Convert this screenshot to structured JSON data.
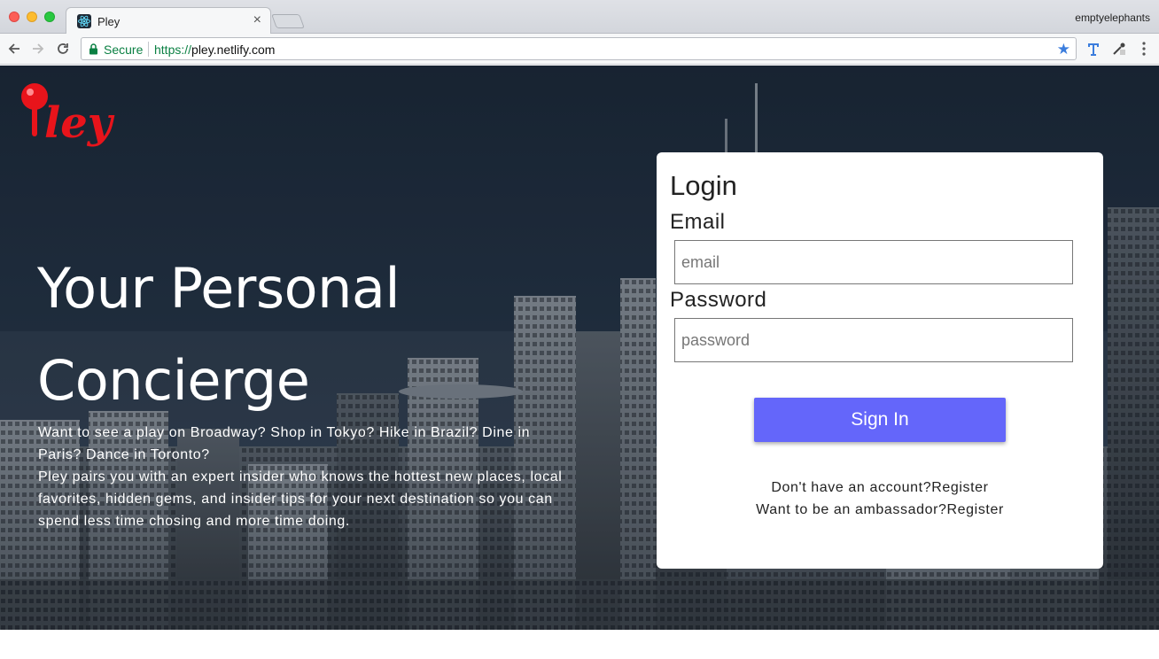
{
  "browser": {
    "tab_title": "Pley",
    "tab_close": "×",
    "profile_name": "emptyelephants",
    "secure_label": "Secure",
    "url_scheme": "https://",
    "url_host": "pley.netlify.com",
    "icons": {
      "back": "arrow-left-icon",
      "forward": "arrow-right-icon",
      "reload": "reload-icon",
      "lock": "lock-icon",
      "bookmark": "star-icon",
      "extension_1": "t-extension-icon",
      "extension_2": "eyedropper-icon",
      "menu": "kebab-menu-icon"
    }
  },
  "brand": {
    "logo_text": "ley",
    "logo_color": "#e8141b"
  },
  "hero": {
    "headline_line1": "Your Personal",
    "headline_line2": "Concierge",
    "intro_p1": "Want to see a play on Broadway? Shop in Tokyo? Hike in Brazil? Dine in Paris? Dance in Toronto?",
    "intro_p2": "Pley pairs you with an expert insider who knows the hottest new places, local favorites, hidden gems, and insider tips for your next destination so you can spend less time chosing and more time doing."
  },
  "login": {
    "title": "Login",
    "email_label": "Email",
    "email_placeholder": "email",
    "email_value": "",
    "password_label": "Password",
    "password_placeholder": "password",
    "password_value": "",
    "signin_label": "Sign In",
    "signin_color": "#6466fa",
    "register_prompt": "Don't have an account?",
    "register_link": "Register",
    "ambassador_prompt": "Want to be an ambassador?",
    "ambassador_link": "Register"
  }
}
